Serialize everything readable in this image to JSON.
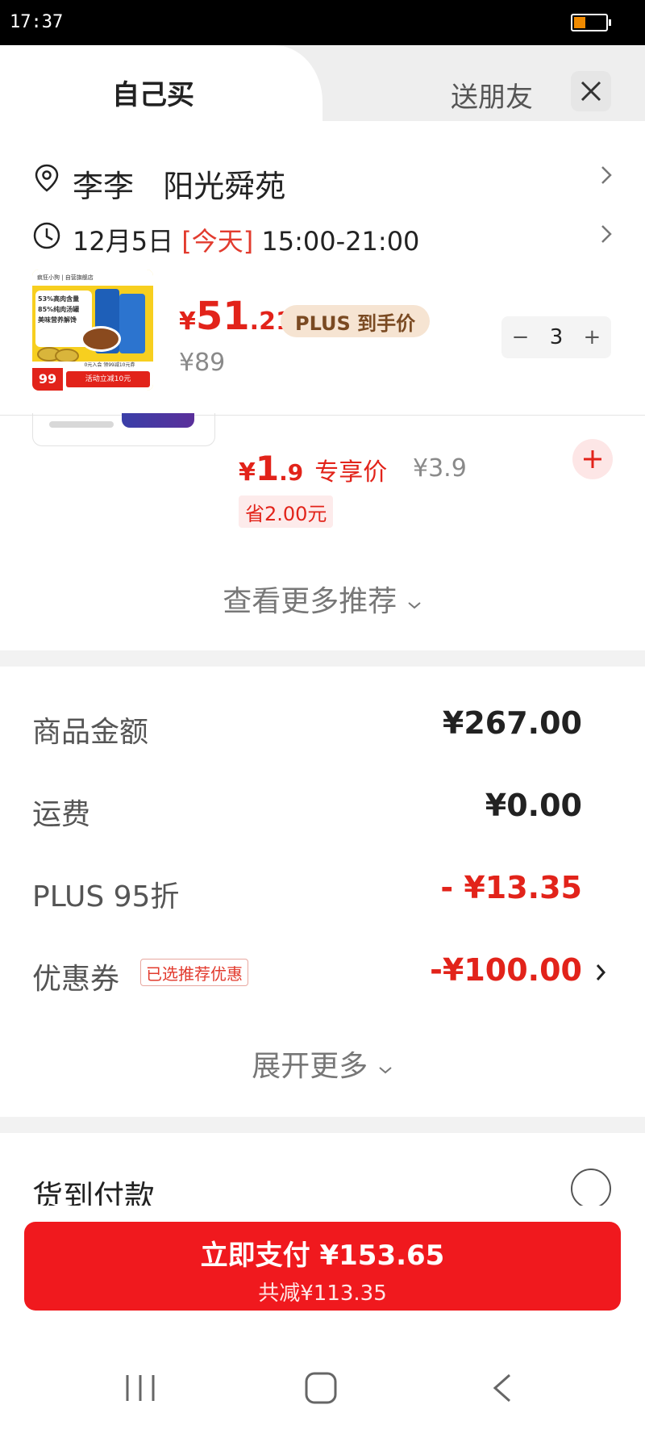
{
  "status": {
    "time": "17:37"
  },
  "tabs": {
    "self": "自己买",
    "friend": "送朋友"
  },
  "address": {
    "name": "李李",
    "place": "阳光舜苑"
  },
  "delivery": {
    "date": "12月5日",
    "today": "[今天]",
    "range": "15:00-21:00"
  },
  "product": {
    "price_yen": "¥",
    "price_int": "51",
    "price_dec": ".21",
    "plus_badge": "PLUS 到手价",
    "orig_price": "¥89",
    "qty": "3",
    "minus": "−",
    "plus": "+",
    "image_texts": {
      "top": "疯狂小狗 | 自营旗舰店",
      "line1": "53%高肉含量",
      "line2": "85%纯肉汤罐",
      "line3": "美味营养解馋",
      "price": "99",
      "coupon": "0元入会 领99减10元券",
      "activity": "活动立减10元"
    }
  },
  "recommend": {
    "price_yen": "¥",
    "price_int": "1",
    "price_dec": ".9",
    "label": "专享价",
    "orig": "¥3.9",
    "save": "省2.00元",
    "more": "查看更多推荐"
  },
  "summary": {
    "goods_label": "商品金额",
    "goods_value": "¥267.00",
    "freight_label": "运费",
    "freight_value": "¥0.00",
    "plus_label": "PLUS 95折",
    "plus_value": "- ¥13.35",
    "coupon_label": "优惠券",
    "coupon_tag": "已选推荐优惠",
    "coupon_value": "-¥100.00",
    "expand": "展开更多"
  },
  "cod": {
    "label": "货到付款"
  },
  "pay": {
    "label": "立即支付 ¥153.65",
    "sub": "共减¥113.35"
  },
  "colors": {
    "accent": "#e2231a",
    "pay_button": "#f0191e",
    "plus_badge_bg": "#f6e4d2"
  }
}
